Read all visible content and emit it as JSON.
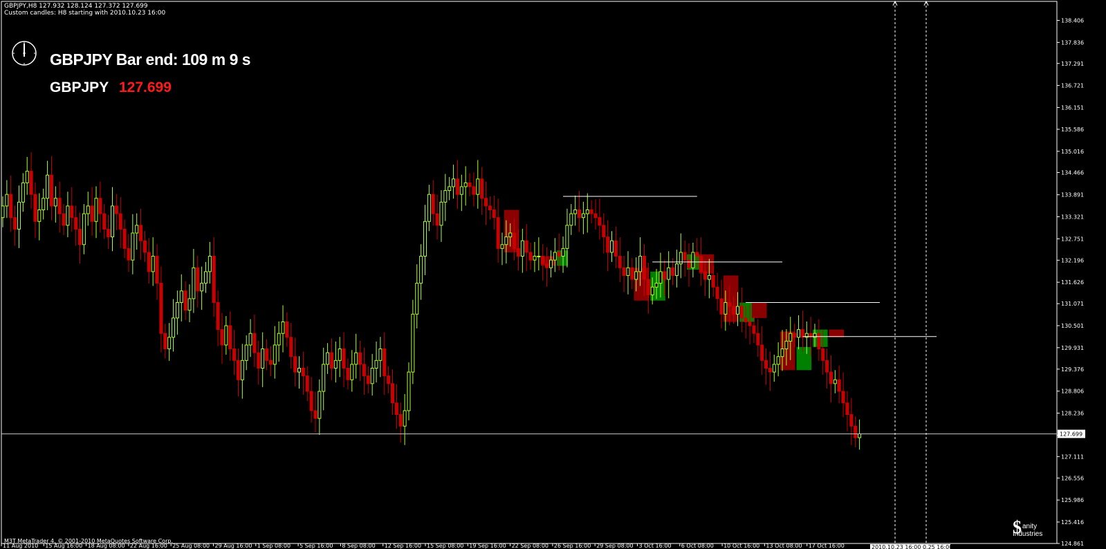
{
  "header": {
    "line1": "GBPJPY,H8  127.932 128.124 127.372 127.699",
    "line2": "Custom candles: H8 starting with 2010.10.23 16:00"
  },
  "overlay": {
    "bar_end_text": "GBPJPY Bar end: 109 m 9 s",
    "symbol": "GBPJPY",
    "bid": "127.699"
  },
  "footer": {
    "copyright": "M3T MetaTrader 4, © 2001-2010 MetaQuotes Software Corp.",
    "logo_text_1": "anity",
    "logo_text_2": "Industries",
    "logo_symbol": "$"
  },
  "colors": {
    "background": "#000000",
    "bull": "#adff2f",
    "bear": "#cc0000",
    "bull_box": "#008000",
    "bear_box": "#8b0000",
    "current_price_line": "#c0c0c0",
    "bid_text": "#ff1a1a"
  },
  "chart_data": {
    "type": "candlestick",
    "y_ticks": [
      "138.406",
      "137.836",
      "137.291",
      "136.721",
      "136.151",
      "135.586",
      "135.016",
      "134.466",
      "133.891",
      "133.321",
      "132.751",
      "132.196",
      "131.626",
      "131.071",
      "130.501",
      "129.931",
      "129.376",
      "128.806",
      "128.236",
      "127.666",
      "127.111",
      "126.556",
      "125.986",
      "125.416",
      "124.861"
    ],
    "x_ticks": [
      "11 Aug 2010",
      "15 Aug 16:00",
      "18 Aug 08:00",
      "22 Aug 16:00",
      "25 Aug 08:00",
      "29 Aug 16:00",
      "1 Sep 08:00",
      "5 Sep 16:00",
      "8 Sep 08:00",
      "12 Sep 16:00",
      "15 Sep 08:00",
      "19 Sep 16:00",
      "22 Sep 08:00",
      "26 Sep 16:00",
      "29 Sep 08:00",
      "3 Oct 16:00",
      "6 Oct 08:00",
      "10 Oct 16:00",
      "13 Oct 08:00",
      "17 Oct 16:00"
    ],
    "ylim": [
      124.861,
      138.406
    ],
    "current_price": 127.699,
    "current_price_label": "127.699",
    "cursor_time_label": "2010.10.23 16:00",
    "cursor_price_label": "0.25 16:00",
    "levels": [
      {
        "price": 133.85,
        "start_bar": 138,
        "end_bar": 171
      },
      {
        "price": 132.15,
        "start_bar": 160,
        "end_bar": 192
      },
      {
        "price": 131.1,
        "start_bar": 183,
        "end_bar": 216
      },
      {
        "price": 130.22,
        "start_bar": 197,
        "end_bar": 230
      }
    ],
    "boxes": [
      {
        "start_bar": 124,
        "end_bar": 127,
        "open": 133.5,
        "close": 132.4
      },
      {
        "start_bar": 133,
        "end_bar": 136,
        "open": 132.3,
        "close": 132.05
      },
      {
        "start_bar": 137,
        "end_bar": 139,
        "open": 132.05,
        "close": 132.45
      },
      {
        "start_bar": 156,
        "end_bar": 159,
        "open": 132.0,
        "close": 131.15
      },
      {
        "start_bar": 160,
        "end_bar": 163,
        "open": 131.15,
        "close": 131.9
      },
      {
        "start_bar": 169,
        "end_bar": 172,
        "open": 131.95,
        "close": 132.35
      },
      {
        "start_bar": 172,
        "end_bar": 175,
        "open": 132.35,
        "close": 131.85
      },
      {
        "start_bar": 178,
        "end_bar": 181,
        "open": 131.8,
        "close": 130.6
      },
      {
        "start_bar": 182,
        "end_bar": 185,
        "open": 130.6,
        "close": 131.1
      },
      {
        "start_bar": 185,
        "end_bar": 188,
        "open": 131.1,
        "close": 130.7
      },
      {
        "start_bar": 192,
        "end_bar": 195,
        "open": 130.35,
        "close": 129.35
      },
      {
        "start_bar": 196,
        "end_bar": 199,
        "open": 129.35,
        "close": 129.95
      },
      {
        "start_bar": 200,
        "end_bar": 203,
        "open": 129.95,
        "close": 130.4
      },
      {
        "start_bar": 204,
        "end_bar": 207,
        "open": 130.4,
        "close": 130.2
      }
    ],
    "series_close": [
      133.6,
      133.9,
      133.3,
      133.0,
      133.7,
      134.2,
      134.5,
      133.9,
      133.2,
      133.5,
      133.8,
      134.4,
      133.6,
      133.8,
      133.4,
      133.1,
      133.6,
      133.3,
      133.0,
      132.6,
      133.4,
      133.6,
      133.2,
      133.8,
      133.4,
      133.0,
      132.8,
      133.6,
      133.4,
      133.0,
      132.5,
      132.2,
      132.9,
      133.1,
      132.7,
      132.4,
      131.9,
      132.3,
      131.6,
      130.3,
      129.9,
      130.2,
      130.7,
      131.1,
      131.4,
      130.9,
      131.2,
      132.0,
      131.4,
      131.6,
      131.9,
      132.3,
      131.1,
      130.4,
      130.0,
      130.5,
      129.9,
      129.6,
      129.1,
      129.6,
      130.0,
      130.3,
      129.8,
      129.4,
      129.9,
      129.6,
      129.5,
      130.0,
      130.3,
      130.6,
      130.2,
      129.7,
      129.3,
      129.4,
      129.2,
      128.8,
      128.3,
      128.1,
      128.8,
      129.5,
      129.8,
      129.4,
      129.6,
      129.9,
      129.4,
      129.1,
      129.5,
      129.8,
      129.5,
      129.2,
      129.0,
      129.4,
      129.6,
      129.9,
      129.2,
      129.0,
      128.5,
      128.2,
      127.9,
      128.3,
      129.3,
      130.8,
      131.6,
      132.3,
      133.2,
      133.9,
      133.4,
      133.1,
      133.7,
      134.0,
      134.1,
      134.3,
      133.9,
      134.1,
      134.2,
      134.1,
      133.9,
      134.3,
      133.8,
      133.6,
      133.5,
      133.3,
      132.5,
      132.6,
      132.8,
      132.9,
      132.5,
      132.3,
      132.7,
      132.4,
      132.2,
      132.3,
      132.3,
      132.1,
      132.0,
      132.2,
      132.4,
      132.3,
      132.5,
      133.1,
      133.4,
      133.5,
      133.3,
      133.4,
      133.5,
      133.4,
      133.3,
      133.1,
      132.8,
      132.4,
      132.7,
      132.3,
      132.0,
      131.8,
      132.0,
      131.7,
      131.9,
      132.3,
      131.7,
      131.3,
      131.5,
      131.6,
      131.9,
      131.7,
      132.0,
      131.8,
      132.1,
      132.4,
      132.2,
      132.0,
      132.4,
      132.3,
      131.9,
      131.7,
      131.8,
      131.5,
      131.2,
      130.8,
      131.1,
      131.0,
      130.8,
      131.0,
      130.7,
      130.6,
      130.5,
      130.3,
      130.0,
      129.6,
      129.4,
      129.3,
      129.5,
      129.7,
      129.9,
      130.1,
      130.3,
      130.2,
      130.4,
      130.2,
      130.3,
      130.2,
      130.3,
      129.9,
      129.6,
      129.3,
      129.0,
      129.1,
      128.8,
      128.5,
      128.2,
      127.9,
      127.6,
      127.7
    ]
  }
}
